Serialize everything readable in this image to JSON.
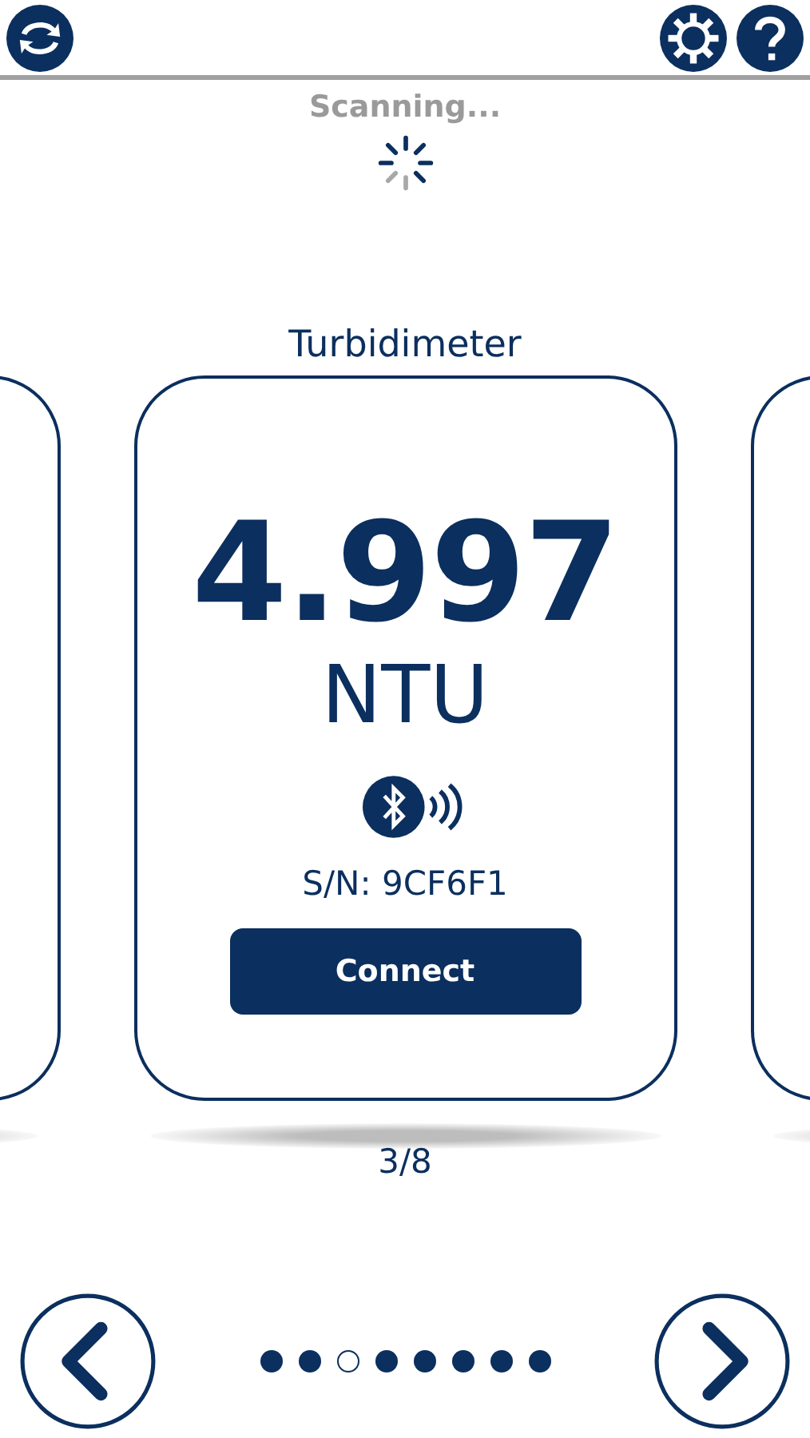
{
  "status": "Scanning...",
  "device": {
    "title": "Turbidimeter",
    "reading": "4.997",
    "unit": "NTU",
    "serial": "S/N: 9CF6F1",
    "button": "Connect"
  },
  "counter": "3/8",
  "page_dots": [
    {
      "selected": false
    },
    {
      "selected": false
    },
    {
      "selected": true
    },
    {
      "selected": false
    },
    {
      "selected": false
    },
    {
      "selected": false
    },
    {
      "selected": false
    },
    {
      "selected": false
    }
  ]
}
